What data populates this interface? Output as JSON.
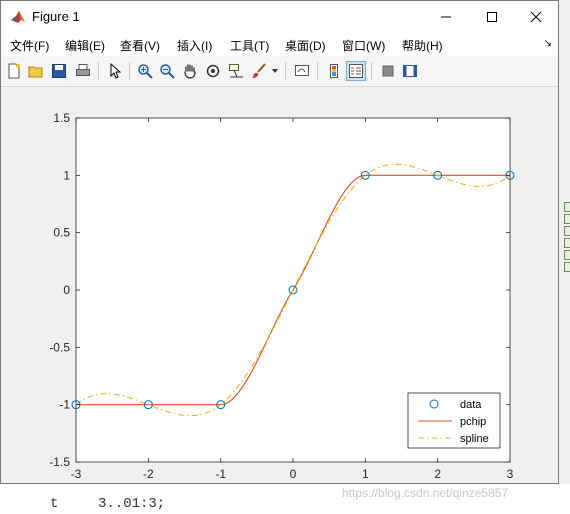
{
  "window": {
    "title": "Figure 1"
  },
  "menu": {
    "items": [
      "文件(F)",
      "编辑(E)",
      "查看(V)",
      "插入(I)",
      "工具(T)",
      "桌面(D)",
      "窗口(W)",
      "帮助(H)"
    ]
  },
  "toolbar": {
    "icons": [
      "new-figure-icon",
      "open-file-icon",
      "save-icon",
      "print-icon",
      "edit-plot-arrow-icon",
      "zoom-in-icon",
      "zoom-out-icon",
      "pan-hand-icon",
      "rotate-3d-icon",
      "data-cursor-icon",
      "brush-icon",
      "link-plot-icon",
      "colorbar-icon",
      "legend-icon",
      "hide-plot-tools-icon",
      "show-plot-tools-icon"
    ],
    "pressed": "legend-icon"
  },
  "background": {
    "code_fragment_left": "t",
    "code_fragment_right": "3..01:3;",
    "watermark": "https://blog.csdn.net/qinze5857"
  },
  "chart_data": {
    "type": "line",
    "xlim": [
      -3,
      3
    ],
    "ylim": [
      -1.5,
      1.5
    ],
    "x_ticks": [
      "-3",
      "-2",
      "-1",
      "0",
      "1",
      "2",
      "3"
    ],
    "y_ticks": [
      "1.5",
      "1",
      "0.5",
      "0",
      "-0.5",
      "-1",
      "-1.5"
    ],
    "grid": false,
    "legend_position": "bottom-right",
    "colors": {
      "data": "#0072bd",
      "pchip": "#d95319",
      "spline": "#edb120"
    },
    "series": [
      {
        "name": "data",
        "style": "markers-circle",
        "x": [
          -3,
          -2,
          -1,
          0,
          1,
          2,
          3
        ],
        "y": [
          -1,
          -1,
          -1,
          0,
          1,
          1,
          1
        ]
      },
      {
        "name": "pchip",
        "style": "solid",
        "x": [
          -3,
          -2,
          -1,
          0,
          1,
          2,
          3
        ],
        "y": [
          -1,
          -1,
          -1,
          0,
          1,
          1,
          1
        ]
      },
      {
        "name": "spline",
        "style": "dash-dot",
        "x": [
          -3,
          -2,
          -1,
          0,
          1,
          2,
          3
        ],
        "y": [
          -1,
          -1,
          -1,
          0,
          1,
          1,
          1
        ]
      }
    ]
  }
}
